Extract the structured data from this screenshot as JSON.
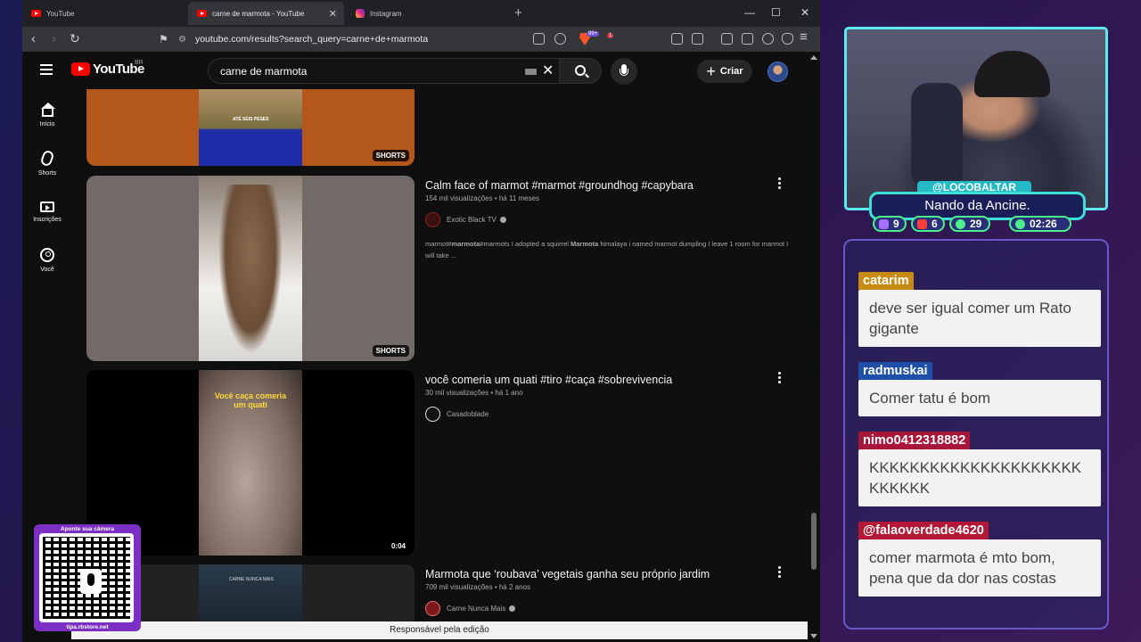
{
  "browser": {
    "tabs": [
      {
        "label": "YouTube",
        "icon": "youtube-icon"
      },
      {
        "label": "carne de marmota - YouTube",
        "icon": "youtube-icon"
      },
      {
        "label": "Instagram",
        "icon": "instagram-icon"
      }
    ],
    "url": "youtube.com/results?search_query=carne+de+marmota",
    "badges": {
      "brave": "99+",
      "ext": "1"
    }
  },
  "youtube": {
    "logo_text": "YouTube",
    "country": "BR",
    "search_value": "carne de marmota",
    "create_label": "Criar",
    "sidebar": [
      {
        "label": "Início",
        "icon": "home-icon"
      },
      {
        "label": "Shorts",
        "icon": "shorts-icon"
      },
      {
        "label": "Inscrições",
        "icon": "subscriptions-icon"
      },
      {
        "label": "Você",
        "icon": "you-icon"
      }
    ],
    "results": [
      {
        "thumb_caption": "ATÉ SEIS PESES",
        "badge": "SHORTS"
      },
      {
        "title": "Calm face of marmot #marmot #groundhog #capybara",
        "views": "154 mil visualizações",
        "age": "há 11 meses",
        "channel": "Exotic Black TV",
        "desc_pre": "marmot#",
        "desc_b1": "marmota",
        "desc_mid": "#marmots I adopted a squirrel ",
        "desc_b2": "Marmota",
        "desc_post": " himalaya i named marmot dumpling I leave 1 room for marmot I will take ...",
        "badge": "SHORTS"
      },
      {
        "title": "você comeria um quati #tiro #caça #sobrevivencia",
        "views": "30 mil visualizações",
        "age": "há 1 ano",
        "channel": "Casadoblade",
        "thumb_caption": "Você caça comeria um quati",
        "duration": "0:04"
      },
      {
        "title": "Marmota que ‘roubava’ vegetais ganha seu próprio jardim",
        "views": "709 mil visualizações",
        "age": "há 2 anos",
        "channel": "Carne Nunca Mais",
        "thumb_caption": "CARNE NUNCA MAIS"
      }
    ],
    "footer_notice": "Responsável pela edição"
  },
  "qr": {
    "top_text": "Aponte sua câmera",
    "bottom_text": "tipa.rbstore.net"
  },
  "stream": {
    "handle": "@LOCOBALTAR",
    "name": "Nando da Ancine.",
    "stats": {
      "twitch": "9",
      "youtube": "6",
      "viewers": "29",
      "time": "02:26"
    }
  },
  "chat": [
    {
      "user": "catarim",
      "color": "#c98a12",
      "text": "deve ser igual comer um Rato gigante"
    },
    {
      "user": "radmuskai",
      "color": "#1d4fa8",
      "text": "Comer tatu é bom"
    },
    {
      "user": "nimo0412318882",
      "color": "#a8173a",
      "text": "KKKKKKKKKKKKKKKKKKKKKKKKKKK"
    },
    {
      "user": "@falaoverdade4620",
      "color": "#b51836",
      "text": "comer marmota é mto bom, pena que da dor nas costas"
    }
  ]
}
